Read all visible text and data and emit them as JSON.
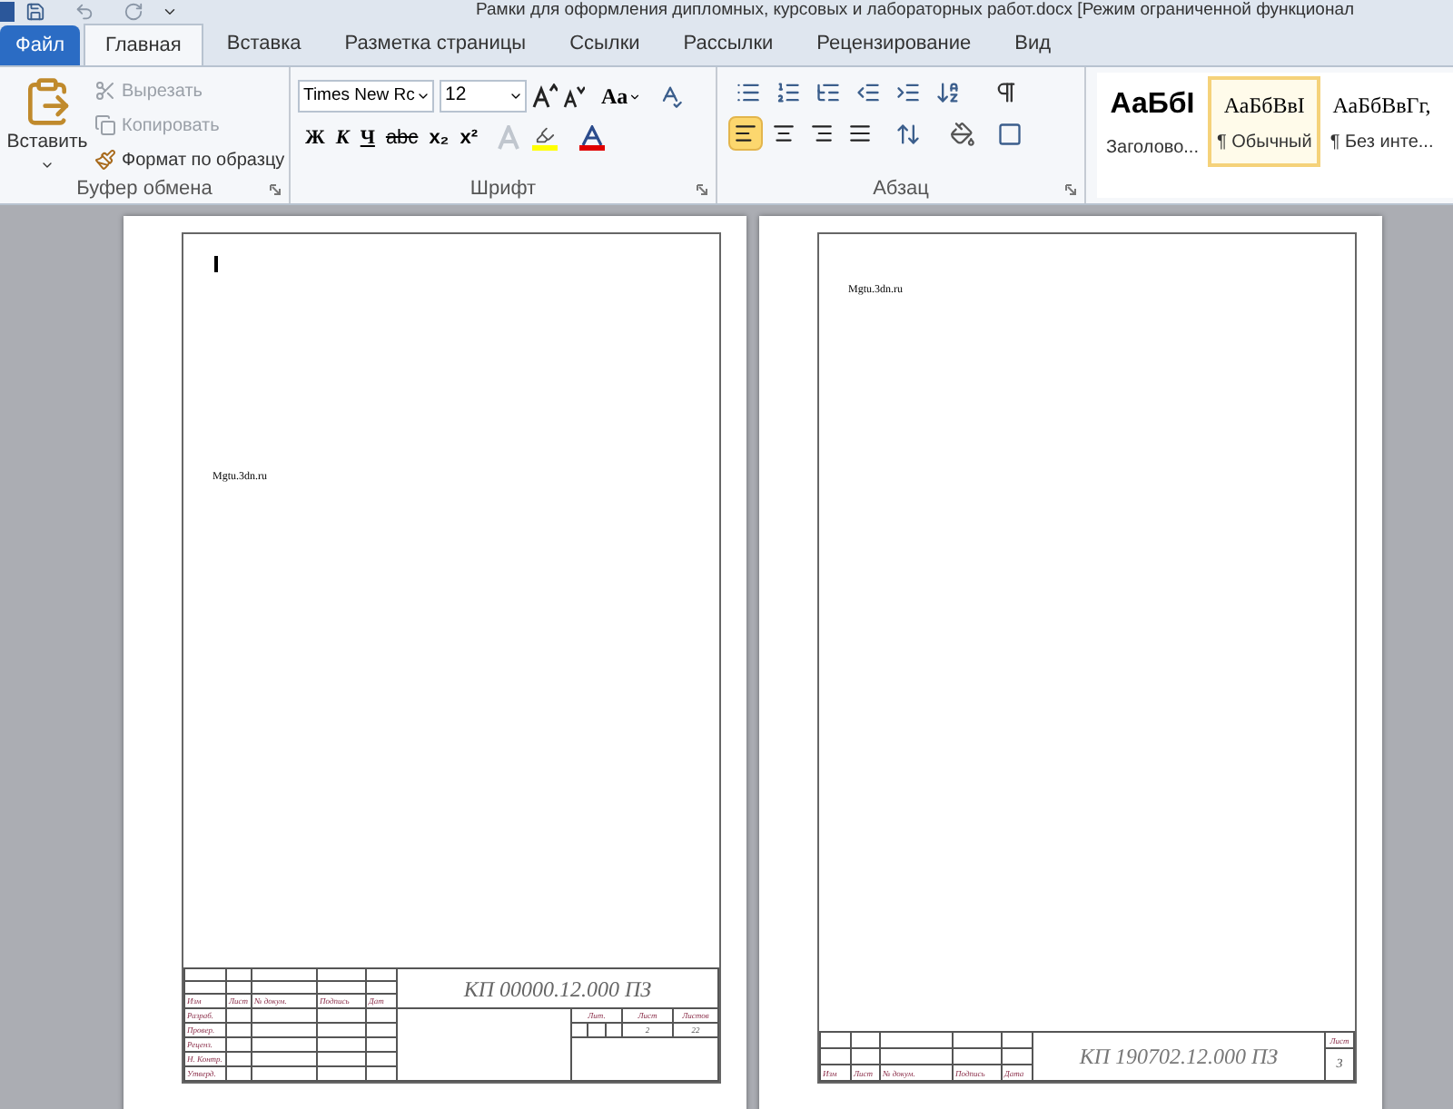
{
  "title_bar": {
    "title": "Рамки для оформления дипломных, курсовых и лабораторных работ.docx [Режим ограниченной функционал"
  },
  "tabs": [
    {
      "label": "Файл",
      "kind": "file",
      "selected": false
    },
    {
      "label": "Главная",
      "kind": "tab",
      "selected": true
    },
    {
      "label": "Вставка",
      "kind": "tab",
      "selected": false
    },
    {
      "label": "Разметка страницы",
      "kind": "tab",
      "selected": false
    },
    {
      "label": "Ссылки",
      "kind": "tab",
      "selected": false
    },
    {
      "label": "Рассылки",
      "kind": "tab",
      "selected": false
    },
    {
      "label": "Рецензирование",
      "kind": "tab",
      "selected": false
    },
    {
      "label": "Вид",
      "kind": "tab",
      "selected": false
    }
  ],
  "clipboard": {
    "label": "Буфер обмена",
    "paste": "Вставить",
    "actions": [
      {
        "label": "Вырезать",
        "disabled": true
      },
      {
        "label": "Копировать",
        "disabled": true
      },
      {
        "label": "Формат по образцу",
        "disabled": false
      }
    ]
  },
  "font": {
    "label": "Шрифт",
    "font_name": "Times New Rc",
    "font_size": "12",
    "case_button": "Aa",
    "format_buttons": [
      "Ж",
      "К",
      "Ч",
      "abc",
      "x₂",
      "x²"
    ]
  },
  "paragraph": {
    "label": "Абзац",
    "alignments": [
      {
        "selected": true
      },
      {
        "selected": false
      },
      {
        "selected": false
      },
      {
        "selected": false
      }
    ]
  },
  "styles": [
    {
      "sample": "АаБбI",
      "name": "Заголово...",
      "selected": false,
      "kind": "heading"
    },
    {
      "sample": "АаБбВвI",
      "name": "¶ Обычный",
      "selected": true,
      "kind": "normal"
    },
    {
      "sample": "АаБбВвГг,",
      "name": "¶ Без инте...",
      "selected": false,
      "kind": "normal"
    }
  ],
  "pages": [
    {
      "cursor": true,
      "text": "Mgtu.3dn.ru",
      "stamp": {
        "kind": "full",
        "designation": "КП 00000.12.000 ПЗ",
        "columns": [
          "Изм",
          "Лист",
          "№ докум.",
          "Подпись",
          "Дат"
        ],
        "rows": [
          "Разраб.",
          "Провер.",
          "Реценз.",
          "Н. Контр.",
          "Утверд."
        ],
        "sheet_headers": [
          "Лит.",
          "Лист",
          "Листов"
        ],
        "sheet_values": [
          "2",
          "22"
        ]
      }
    },
    {
      "cursor": false,
      "text": "Mgtu.3dn.ru",
      "stamp": {
        "kind": "short",
        "designation": "КП 190702.12.000 ПЗ",
        "columns": [
          "Изм",
          "Лист",
          "№ докум.",
          "Подпись",
          "Дата"
        ],
        "sheet_header": "Лист",
        "sheet_value": "3"
      }
    }
  ]
}
